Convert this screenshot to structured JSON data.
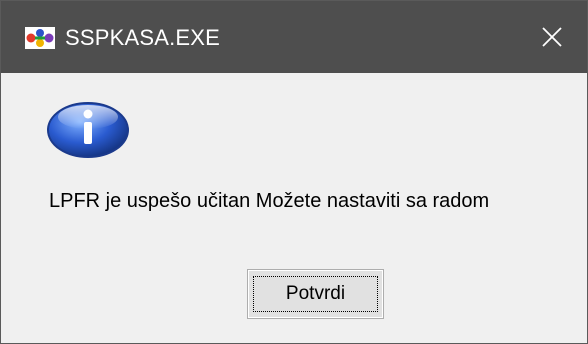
{
  "window": {
    "title": "SSPKASA.EXE",
    "app_icon": "sspkasa-app-icon",
    "close_icon": "close-icon"
  },
  "dialog": {
    "icon": "information-icon",
    "message": "LPFR je uspešo učitan Možete nastaviti sa radom",
    "ok_button_label": "Potvrdi"
  },
  "colors": {
    "titlebar": "#4e4e4e",
    "title_text": "#ffffff",
    "body": "#f0f0f0",
    "button_face": "#e1e1e1",
    "button_border": "#adadad",
    "info_icon_blue": "#2a5bd0"
  }
}
